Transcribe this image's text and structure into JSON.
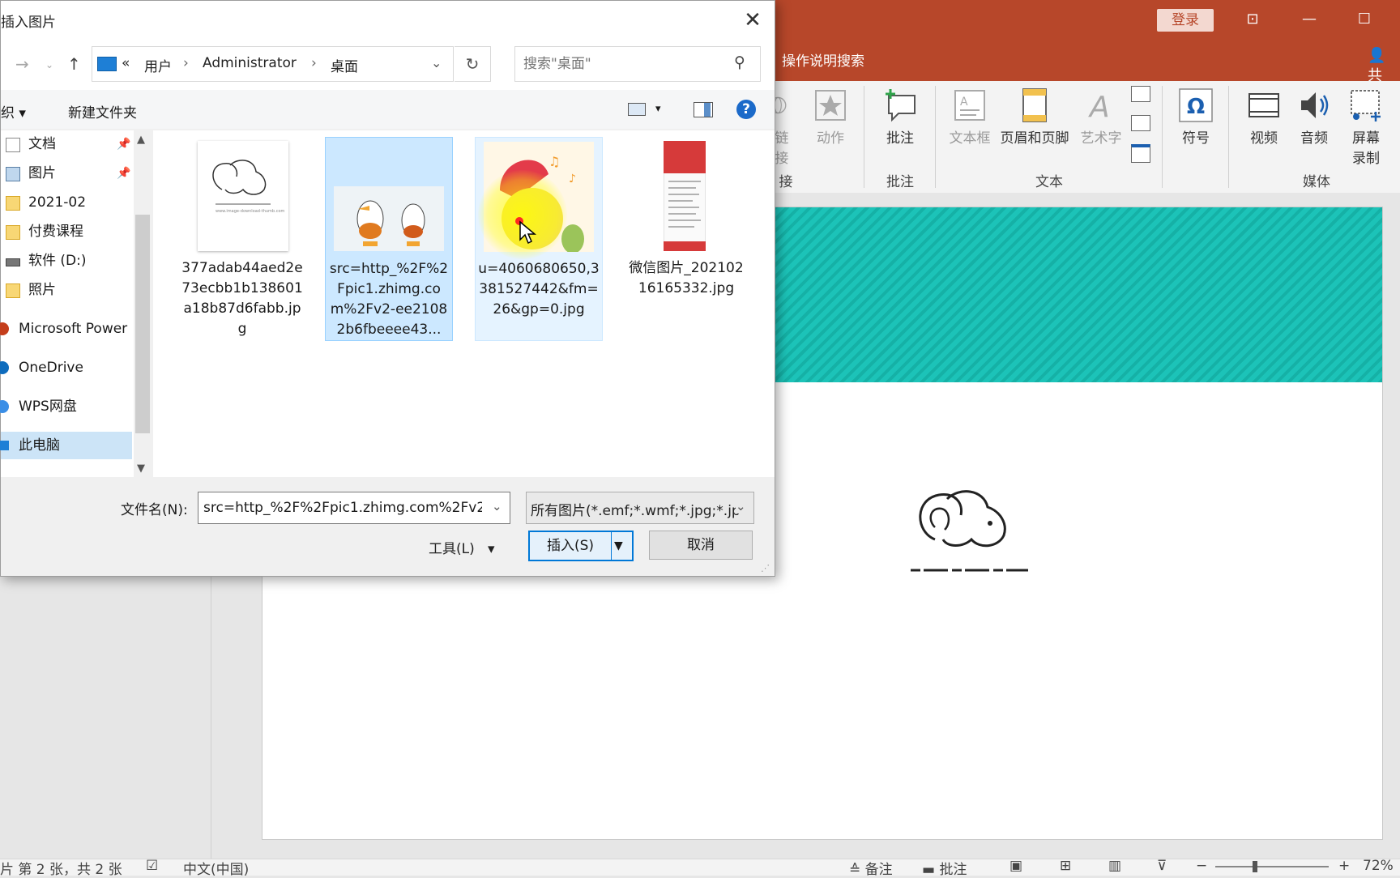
{
  "ppt": {
    "login_label": "登录",
    "tell_me_label": "操作说明搜索",
    "share_label": "共",
    "ribbon": {
      "link_label": "链接",
      "link_label_top": "链",
      "link_label_bottom": "接",
      "action_label": "动作",
      "comment_label": "批注",
      "textbox_label": "文本框",
      "header_footer_label": "页眉和页脚",
      "wordart_label": "艺术字",
      "symbol_label": "符号",
      "video_label": "视频",
      "audio_label": "音频",
      "screen_rec_label_1": "屏幕",
      "screen_rec_label_2": "录制",
      "groups": {
        "links": "接",
        "comments": "批注",
        "text": "文本",
        "media": "媒体"
      }
    },
    "status": {
      "slide_info": "片 第 2 张，共 2 张",
      "language": "中文(中国)",
      "notes": "备注",
      "comments": "批注",
      "zoom": "72%"
    }
  },
  "dialog": {
    "title": "插入图片",
    "close_glyph": "✕",
    "breadcrumb": {
      "prefix": "«",
      "items": [
        "用户",
        "Administrator",
        "桌面"
      ]
    },
    "search_placeholder": "搜索\"桌面\"",
    "toolbar": {
      "organize": "织",
      "new_folder": "新建文件夹"
    },
    "nav_items": [
      "文档",
      "图片",
      "2021-02",
      "付费课程",
      "软件 (D:)",
      "照片",
      "Microsoft Power",
      "OneDrive",
      "WPS网盘",
      "此电脑"
    ],
    "files": [
      {
        "name": "377adab44aed2e73ecbb1b138601a18b87d6fabb.jpg"
      },
      {
        "name": "src=http_%2F%2Fpic1.zhimg.com%2Fv2-ee21082b6fbeeee43..."
      },
      {
        "name": "u=4060680650,3381527442&fm=26&gp=0.jpg"
      },
      {
        "name": "微信图片_20210216165332.jpg"
      }
    ],
    "filename_label": "文件名(N):",
    "filename_value": "src=http_%2F%2Fpic1.zhimg.com%2Fv2-",
    "filetype_value": "所有图片(*.emf;*.wmf;*.jpg;*.jp",
    "tools_label": "工具(L)",
    "insert_label": "插入(S)",
    "cancel_label": "取消"
  },
  "colors": {
    "ppt_accent": "#b7472a",
    "selection": "#cce8ff",
    "slide_band": "#1cc3b8"
  }
}
